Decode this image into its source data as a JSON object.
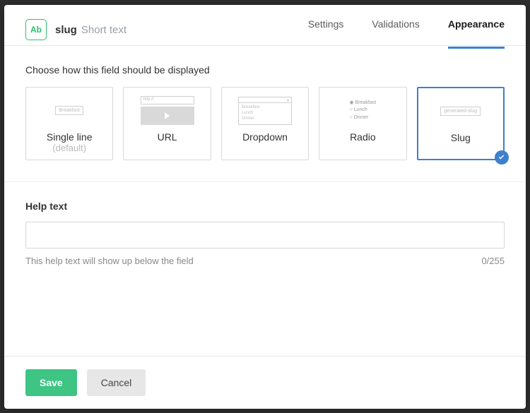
{
  "header": {
    "icon_text": "Ab",
    "field_name": "slug",
    "field_type": "Short text"
  },
  "tabs": {
    "settings": "Settings",
    "validations": "Validations",
    "appearance": "Appearance"
  },
  "appearance": {
    "prompt": "Choose how this field should be displayed",
    "options": [
      {
        "label": "Single line",
        "sub": "(default)",
        "preview_text": "Breakfast"
      },
      {
        "label": "URL",
        "preview_text": "http://"
      },
      {
        "label": "Dropdown",
        "items": [
          "Breakfast",
          "Lunch",
          "Dinner"
        ]
      },
      {
        "label": "Radio",
        "items": [
          "Breakfast",
          "Lunch",
          "Dinner"
        ]
      },
      {
        "label": "Slug",
        "preview_text": "generated-slug"
      }
    ],
    "selected": "Slug"
  },
  "help_text": {
    "label": "Help text",
    "value": "",
    "hint": "This help text will show up below the field",
    "counter": "0/255"
  },
  "footer": {
    "save": "Save",
    "cancel": "Cancel"
  }
}
